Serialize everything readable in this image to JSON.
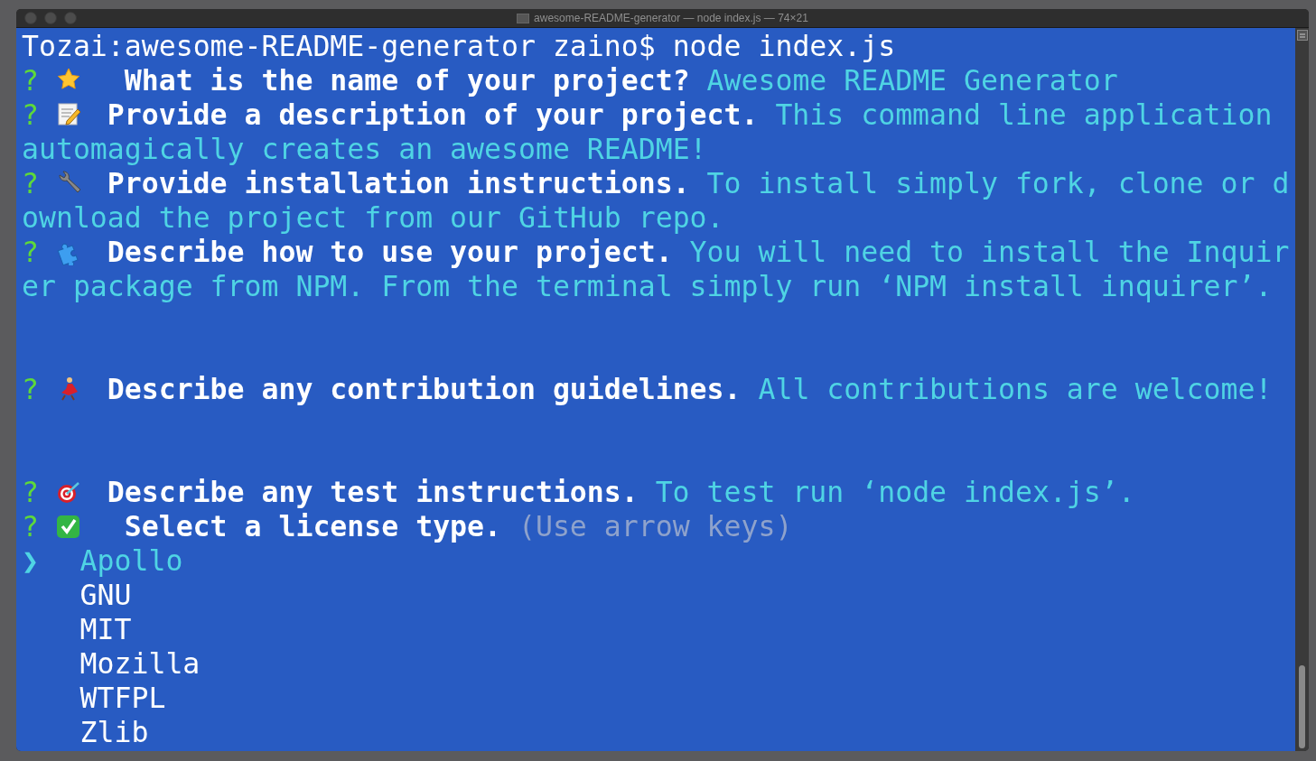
{
  "window": {
    "title": "awesome-README-generator — node index.js — 74×21"
  },
  "terminal": {
    "rows": [
      {
        "kind": "command",
        "text": "Tozai:awesome-README-generator zaino$ node index.js"
      },
      {
        "kind": "question",
        "prompt": "?",
        "text": "What is the name of your project?",
        "answer": "Awesome README Generator"
      },
      {
        "kind": "question",
        "prompt": "?",
        "text": "Provide a description of your project.",
        "answer": "This command line application"
      },
      {
        "kind": "continuation",
        "text": "automagically creates an awesome README!"
      },
      {
        "kind": "question",
        "prompt": "?",
        "text": "Provide installation instructions.",
        "answer": "To install simply fork, clone or d"
      },
      {
        "kind": "continuation",
        "text": "ownload the project from our GitHub repo."
      },
      {
        "kind": "question",
        "prompt": "?",
        "text": "Describe how to use your project.",
        "answer": "You will need to install the Inquir"
      },
      {
        "kind": "continuation",
        "text": "er package from NPM. From the terminal simply run ‘NPM install inquirer’."
      },
      {
        "kind": "blank"
      },
      {
        "kind": "blank"
      },
      {
        "kind": "question",
        "prompt": "?",
        "text": "Describe any contribution guidelines.",
        "answer": "All contributions are welcome!"
      },
      {
        "kind": "blank"
      },
      {
        "kind": "blank"
      },
      {
        "kind": "question",
        "prompt": "?",
        "text": "Describe any test instructions.",
        "answer": "To test run ‘node index.js’."
      },
      {
        "kind": "question",
        "prompt": "?",
        "text": "Select a license type.",
        "hint": "(Use arrow keys)"
      }
    ],
    "pointer": "❯",
    "options": [
      {
        "label": "Apollo",
        "selected": true
      },
      {
        "label": "GNU",
        "selected": false
      },
      {
        "label": "MIT",
        "selected": false
      },
      {
        "label": "Mozilla",
        "selected": false
      },
      {
        "label": "WTFPL",
        "selected": false
      },
      {
        "label": "Zlib",
        "selected": false
      }
    ]
  }
}
